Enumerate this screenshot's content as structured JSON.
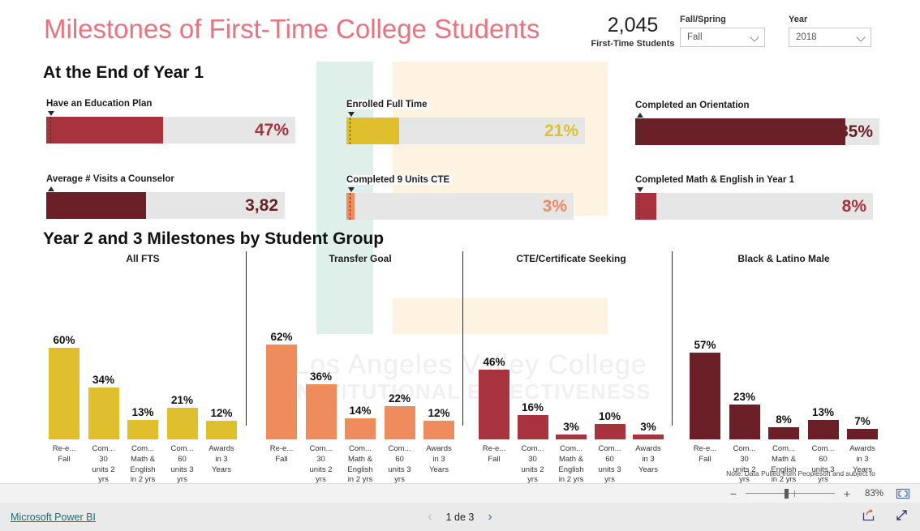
{
  "header": {
    "title": "Milestones of First-Time College Students",
    "total_value": "2,045",
    "total_label": "First-Time Students",
    "slicers": [
      {
        "label": "Fall/Spring",
        "value": "Fall",
        "icon": "chevron-down-icon"
      },
      {
        "label": "Year",
        "value": "2018",
        "icon": "chevron-down-icon"
      }
    ]
  },
  "watermark": {
    "line1": "Los Angeles Valley College",
    "line2": "INSTITUTIONAL EFFECTIVENESS"
  },
  "sections": {
    "year1_heading": "At the End of Year 1",
    "year23_heading": "Year 2 and 3 Milestones by Student Group"
  },
  "kpis": [
    {
      "title": "Have an Education Plan",
      "value_text": "47%",
      "pct": 47,
      "marker_pct": 1.5,
      "trend": "down",
      "color": "#A8333F"
    },
    {
      "title": "Enrolled Full Time",
      "value_text": "21%",
      "pct": 22,
      "marker_pct": 1.5,
      "trend": "down",
      "color": "#DFBF2D"
    },
    {
      "title": "Completed an Orientation",
      "value_text": "85%",
      "pct": 86,
      "marker_pct": 1.5,
      "trend": "up",
      "color": "#6B2028"
    },
    {
      "title": "Average # Visits a Counselor",
      "value_text": "3,82",
      "pct": 42,
      "marker_pct": 1.5,
      "trend": "up",
      "color": "#6B2028"
    },
    {
      "title": "Completed 9 Units CTE",
      "value_text": "3%",
      "pct": 3.5,
      "marker_pct": 1.5,
      "trend": "down",
      "color": "#EE8C5E"
    },
    {
      "title": "Completed Math & English in Year 1",
      "value_text": "8%",
      "pct": 9,
      "marker_pct": 1.5,
      "trend": "down",
      "color": "#A8333F"
    }
  ],
  "chart_data": [
    {
      "type": "bar",
      "title": "All FTS",
      "categories": [
        "Re-e... Fall",
        "Com... 30 units 2 yrs",
        "Com... Math & English in 2 yrs",
        "Com... 60 units 3 yrs",
        "Awards in 3 Years"
      ],
      "category_lines": [
        [
          "Re-e...",
          "Fall"
        ],
        [
          "Com...",
          "30",
          "units 2",
          "yrs"
        ],
        [
          "Com...",
          "Math &",
          "English",
          "in 2 yrs"
        ],
        [
          "Com...",
          "60",
          "units 3",
          "yrs"
        ],
        [
          "Awards",
          "in 3",
          "Years"
        ]
      ],
      "values": [
        60,
        34,
        13,
        21,
        12
      ],
      "value_labels": [
        "60%",
        "34%",
        "13%",
        "21%",
        "12%"
      ],
      "color": "#DFBF2D",
      "ylim": [
        0,
        100
      ],
      "xlabel": "",
      "ylabel": "",
      "grid": false,
      "legend": "none"
    },
    {
      "type": "bar",
      "title": "Transfer Goal",
      "categories": [
        "Re-e... Fall",
        "Com... 30 units 2 yrs",
        "Com... Math & English in 2 yrs",
        "Com... 60 units 3 yrs",
        "Awards in 3 Years"
      ],
      "category_lines": [
        [
          "Re-e...",
          "Fall"
        ],
        [
          "Com...",
          "30",
          "units 2",
          "yrs"
        ],
        [
          "Com...",
          "Math &",
          "English",
          "in 2 yrs"
        ],
        [
          "Com...",
          "60",
          "units 3",
          "yrs"
        ],
        [
          "Awards",
          "in 3",
          "Years"
        ]
      ],
      "values": [
        62,
        36,
        14,
        22,
        12
      ],
      "value_labels": [
        "62%",
        "36%",
        "14%",
        "22%",
        "12%"
      ],
      "color": "#EE8C5E",
      "ylim": [
        0,
        100
      ],
      "xlabel": "",
      "ylabel": "",
      "grid": false,
      "legend": "none"
    },
    {
      "type": "bar",
      "title": "CTE/Certificate Seeking",
      "categories": [
        "Re-e... Fall",
        "Com... 30 units 2 yrs",
        "Com... Math & English in 2 yrs",
        "Com... 60 units 3 yrs",
        "Awards in 3 Years"
      ],
      "category_lines": [
        [
          "Re-e...",
          "Fall"
        ],
        [
          "Com...",
          "30",
          "units 2",
          "yrs"
        ],
        [
          "Com...",
          "Math &",
          "English",
          "in 2 yrs"
        ],
        [
          "Com...",
          "60",
          "units 3",
          "yrs"
        ],
        [
          "Awards",
          "in 3",
          "Years"
        ]
      ],
      "values": [
        46,
        16,
        3,
        10,
        3
      ],
      "value_labels": [
        "46%",
        "16%",
        "3%",
        "10%",
        "3%"
      ],
      "color": "#A8333F",
      "ylim": [
        0,
        100
      ],
      "xlabel": "",
      "ylabel": "",
      "grid": false,
      "legend": "none"
    },
    {
      "type": "bar",
      "title": "Black & Latino Male",
      "categories": [
        "Re-e... Fall",
        "Com... 30 units 2 yrs",
        "Com... Math & English in 2 yrs",
        "Com... 60 units 3 yrs",
        "Awards in 3 Years"
      ],
      "category_lines": [
        [
          "Re-e...",
          "Fall"
        ],
        [
          "Com...",
          "30",
          "units 2",
          "yrs"
        ],
        [
          "Com...",
          "Math &",
          "English",
          "in 2 yrs"
        ],
        [
          "Com...",
          "60",
          "units 3",
          "yrs"
        ],
        [
          "Awards",
          "in 3",
          "Years"
        ]
      ],
      "values": [
        57,
        23,
        8,
        13,
        7
      ],
      "value_labels": [
        "57%",
        "23%",
        "8%",
        "13%",
        "7%"
      ],
      "color": "#6B2028",
      "ylim": [
        0,
        100
      ],
      "xlabel": "",
      "ylabel": "",
      "grid": false,
      "legend": "none"
    }
  ],
  "note": "Note: Data Pulled from Peoplesoft and subject to",
  "zoombar": {
    "minus": "−",
    "plus": "+",
    "percent": "83%",
    "fit_icon": "fit-to-page-icon"
  },
  "footer": {
    "powerbi_link": "Microsoft Power BI",
    "page_text": "1 de 3",
    "prev_icon": "chevron-left-icon",
    "next_icon": "chevron-right-icon",
    "share_icon": "share-icon",
    "fullscreen_icon": "fullscreen-icon"
  },
  "colors": {
    "title_pink": "#e8737e",
    "yellow": "#DFBF2D",
    "orange": "#EE8C5E",
    "crimson": "#A8333F",
    "maroon": "#6B2028",
    "mint_panel": "#dff0ea",
    "cream_panel": "#fdf3e0",
    "track_gray": "#e6e6e6",
    "link_teal": "#1d6e6e"
  }
}
